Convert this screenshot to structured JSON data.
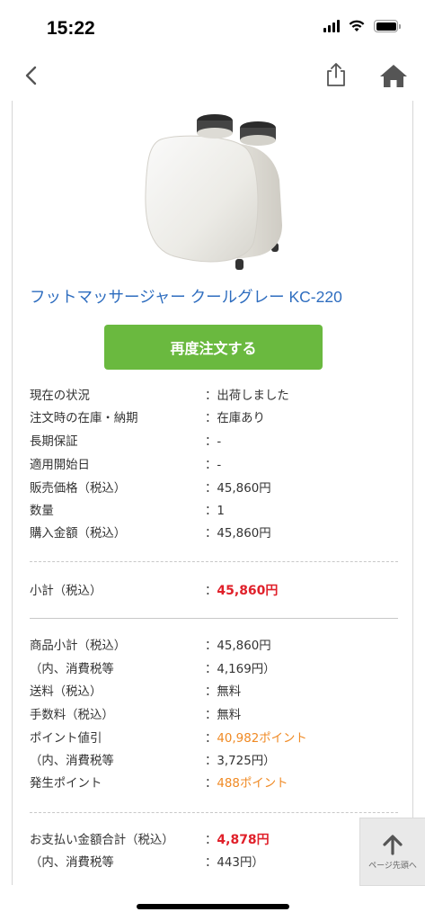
{
  "status_bar": {
    "time": "15:22"
  },
  "product": {
    "title": "フットマッサージャー クールグレー KC-220",
    "reorder_label": "再度注文する"
  },
  "details": [
    {
      "label": "現在の状況",
      "value": "：出荷しました"
    },
    {
      "label": "注文時の在庫・納期",
      "value": "：在庫あり"
    },
    {
      "label": "長期保証",
      "value": "：-"
    },
    {
      "label": "適用開始日",
      "value": "：-"
    },
    {
      "label": "販売価格（税込）",
      "value": "：45,860円"
    },
    {
      "label": "数量",
      "value": "：1"
    },
    {
      "label": "購入金額（税込）",
      "value": "：45,860円"
    }
  ],
  "subtotal": {
    "label": "小計（税込）",
    "colon": "：",
    "value": "45,860円"
  },
  "breakdown": [
    {
      "label": "商品小計（税込）",
      "value": "：45,860円"
    },
    {
      "label": "（内、消費税等",
      "value": "：4,169円）"
    },
    {
      "label": "送料（税込）",
      "value": "：無料"
    },
    {
      "label": "手数料（税込）",
      "value": "：無料"
    },
    {
      "label": "ポイント値引",
      "colon": "：",
      "value": "40,982ポイント"
    },
    {
      "label": "（内、消費税等",
      "value": "：3,725円）"
    },
    {
      "label": "発生ポイント",
      "colon": "：",
      "value": "488ポイント"
    }
  ],
  "total": {
    "label": "お支払い金額合計（税込）",
    "colon": "：",
    "value": "4,878円",
    "tax_label": "（内、消費税等",
    "tax_value": "：443円）"
  },
  "page_top": {
    "label": "ページ先頭へ"
  },
  "colors": {
    "link": "#2e6dbf",
    "button": "#6ab93f",
    "price_red": "#e0202a",
    "points_orange": "#f08a24"
  }
}
